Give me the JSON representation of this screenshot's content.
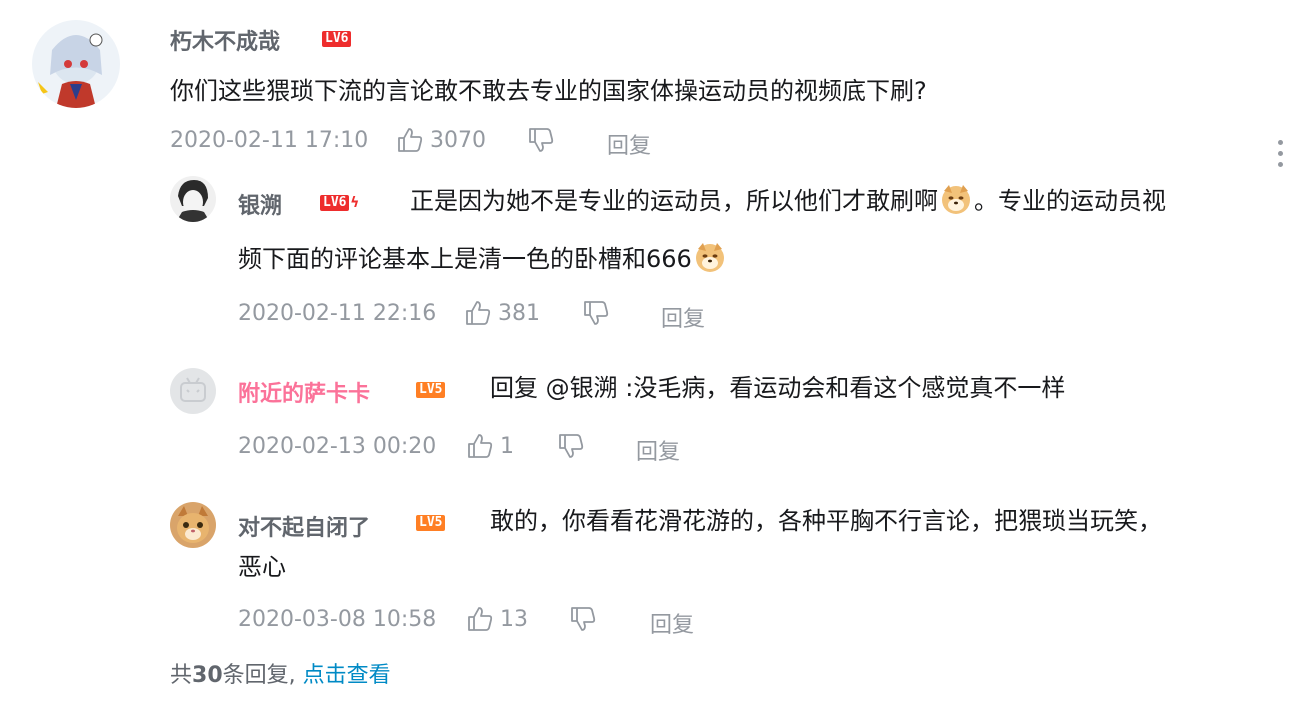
{
  "main_comment": {
    "username": "朽木不成哉",
    "level": "LV6",
    "text": "你们这些猥琐下流的言论敢不敢去专业的国家体操运动员的视频底下刷?",
    "timestamp": "2020-02-11 17:10",
    "likes": "3070",
    "reply_label": "回复"
  },
  "replies": [
    {
      "username": "银溯",
      "level": "LV6",
      "text_part1": "正是因为她不是专业的运动员，所以他们才敢刷啊",
      "text_part2": "。专业的运动员视",
      "text_line2": "频下面的评论基本上是清一色的卧槽和666",
      "timestamp": "2020-02-11 22:16",
      "likes": "381",
      "reply_label": "回复"
    },
    {
      "username": "附近的萨卡卡",
      "level": "LV5",
      "text": "回复 @银溯 :没毛病，看运动会和看这个感觉真不一样",
      "timestamp": "2020-02-13 00:20",
      "likes": "1",
      "reply_label": "回复"
    },
    {
      "username": "对不起自闭了",
      "level": "LV5",
      "text_line1": "敢的，你看看花滑花游的，各种平胸不行言论，把猥琐当玩笑，",
      "text_line2": "恶心",
      "timestamp": "2020-03-08 10:58",
      "likes": "13",
      "reply_label": "回复"
    }
  ],
  "footer": {
    "prefix": "共",
    "count": "30",
    "suffix": "条回复,",
    "link": "点击查看"
  },
  "colors": {
    "lv6": "#ee2d2d",
    "lv5": "#ff7f24",
    "pink_name": "#fb7299",
    "link": "#008ac5",
    "meta": "#9499a0"
  }
}
